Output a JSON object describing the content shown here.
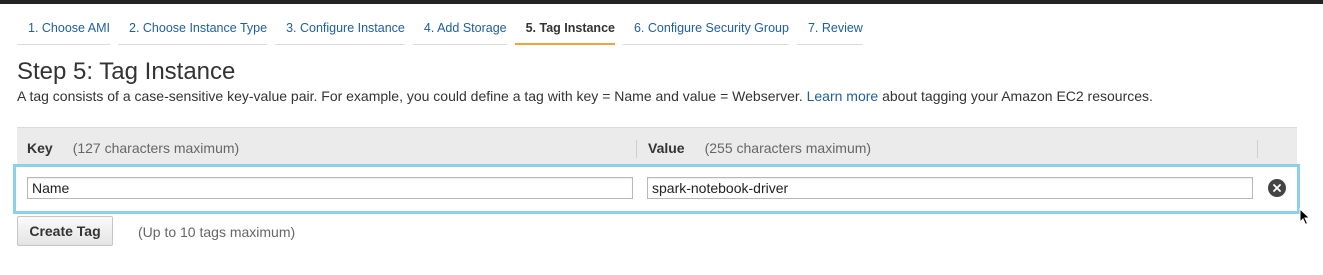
{
  "wizard": {
    "steps": [
      {
        "label": "1. Choose AMI"
      },
      {
        "label": "2. Choose Instance Type"
      },
      {
        "label": "3. Configure Instance"
      },
      {
        "label": "4. Add Storage"
      },
      {
        "label": "5. Tag Instance"
      },
      {
        "label": "6. Configure Security Group"
      },
      {
        "label": "7. Review"
      }
    ],
    "active_step": 4
  },
  "page": {
    "title": "Step 5: Tag Instance",
    "description_before": "A tag consists of a case-sensitive key-value pair. For example, you could define a tag with key = Name and value = Webserver.",
    "learn_more_link": "Learn more",
    "description_after": "about tagging your Amazon EC2 resources."
  },
  "tags_table": {
    "key_header": "Key",
    "key_hint": "(127 characters maximum)",
    "value_header": "Value",
    "value_hint": "(255 characters maximum)",
    "rows": [
      {
        "key": "Name",
        "value": "spark-notebook-driver"
      }
    ]
  },
  "actions": {
    "create_tag_label": "Create Tag",
    "max_note": "(Up to 10 tags maximum)"
  },
  "colors": {
    "link": "#1f5fa0",
    "active_tab_underline": "#f0a23c",
    "row_highlight": "#8ed0e8"
  }
}
